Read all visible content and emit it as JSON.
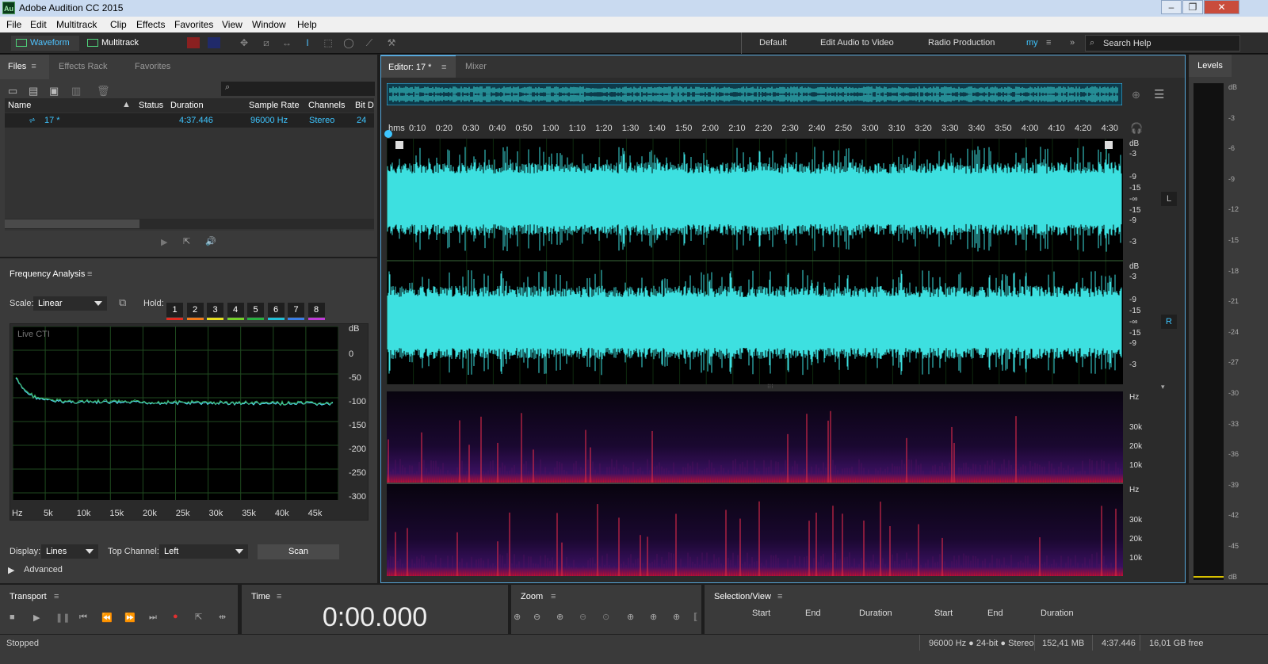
{
  "app": {
    "title": "Adobe Audition CC 2015",
    "logo": "Au"
  },
  "menu": [
    "File",
    "Edit",
    "Multitrack",
    "Clip",
    "Effects",
    "Favorites",
    "View",
    "Window",
    "Help"
  ],
  "toolbar": {
    "waveform": "Waveform",
    "multitrack": "Multitrack",
    "workspaces": [
      "Default",
      "Edit Audio to Video",
      "Radio Production",
      "my"
    ],
    "search": "Search Help"
  },
  "files": {
    "tabs": [
      "Files",
      "Effects Rack",
      "Favorites"
    ],
    "columns": [
      "Name",
      "Status",
      "Duration",
      "Sample Rate",
      "Channels",
      "Bit D"
    ],
    "row": {
      "name": "17 *",
      "duration": "4:37.446",
      "rate": "96000 Hz",
      "channels": "Stereo",
      "bits": "24"
    }
  },
  "freq": {
    "title": "Frequency Analysis",
    "scale_label": "Scale:",
    "scale_value": "Linear",
    "hold_label": "Hold:",
    "hold": [
      "1",
      "2",
      "3",
      "4",
      "5",
      "6",
      "7",
      "8"
    ],
    "hold_colors": [
      "#e02b20",
      "#f27a1a",
      "#e8e020",
      "#76d12a",
      "#28b040",
      "#20c0d8",
      "#3a7ee6",
      "#c03ad8"
    ],
    "live": "Live CTI",
    "y_unit": "dB",
    "y_ticks": [
      "0",
      "-50",
      "-100",
      "-150",
      "-200",
      "-250",
      "-300"
    ],
    "x_ticks": [
      "Hz",
      "5k",
      "10k",
      "15k",
      "20k",
      "25k",
      "30k",
      "35k",
      "40k",
      "45k"
    ],
    "display_label": "Display:",
    "display_value": "Lines",
    "top_channel_label": "Top Channel:",
    "top_channel_value": "Left",
    "scan": "Scan",
    "advanced": "Advanced"
  },
  "editor": {
    "tabs": [
      "Editor: 17 *",
      "Mixer"
    ],
    "time_ticks": [
      "hms",
      "0:10",
      "0:20",
      "0:30",
      "0:40",
      "0:50",
      "1:00",
      "1:10",
      "1:20",
      "1:30",
      "1:40",
      "1:50",
      "2:00",
      "2:10",
      "2:20",
      "2:30",
      "2:40",
      "2:50",
      "3:00",
      "3:10",
      "3:20",
      "3:30",
      "3:40",
      "3:50",
      "4:00",
      "4:10",
      "4:20",
      "4:30"
    ],
    "db_ticks": [
      "dB",
      "-3",
      "-9",
      "-15",
      "-∞",
      "-15",
      "-9",
      "-3"
    ],
    "ch_left": "L",
    "ch_right": "R",
    "hz_ticks": [
      "Hz",
      "30k",
      "20k",
      "10k"
    ],
    "wave_color": "#3de0e0"
  },
  "levels": {
    "title": "Levels",
    "ticks": [
      "dB",
      "-3",
      "-6",
      "-9",
      "-12",
      "-15",
      "-18",
      "-21",
      "-24",
      "-27",
      "-30",
      "-33",
      "-36",
      "-39",
      "-42",
      "-45",
      "dB"
    ]
  },
  "transport": {
    "title": "Transport"
  },
  "time": {
    "title": "Time",
    "value": "0:00.000"
  },
  "zoom": {
    "title": "Zoom"
  },
  "selection": {
    "title": "Selection/View",
    "cols": [
      "Start",
      "End",
      "Duration",
      "Start",
      "End",
      "Duration"
    ]
  },
  "status": {
    "state": "Stopped",
    "format": "96000 Hz ● 24-bit ● Stereo",
    "size": "152,41 MB",
    "duration": "4:37.446",
    "free": "16,01 GB free"
  }
}
